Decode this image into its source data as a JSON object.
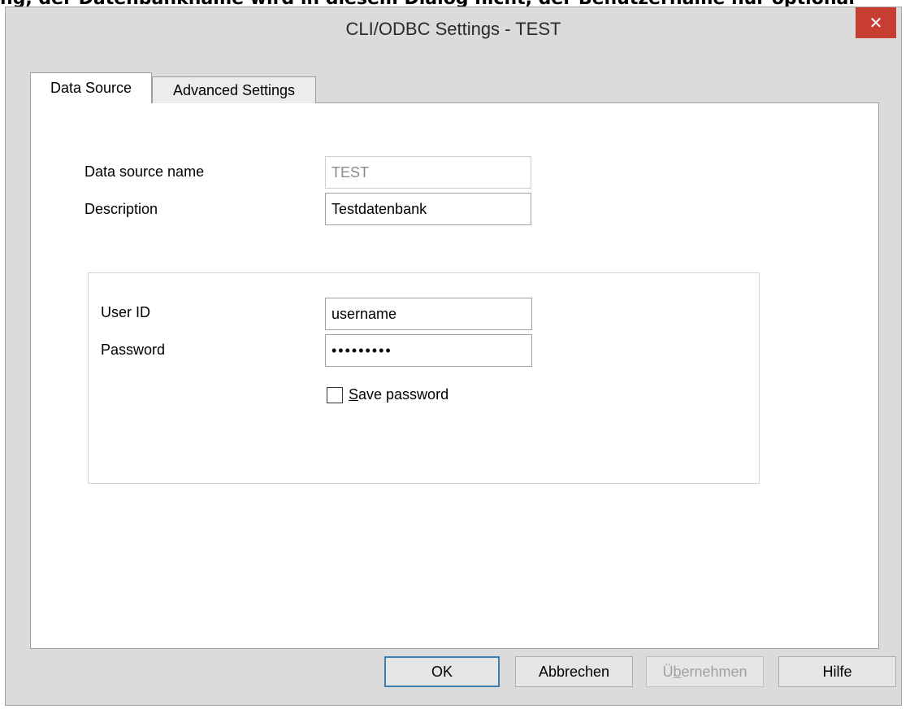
{
  "partial_text": "ng, der Datenbankname wird in diesem Dialog nicht, der Benutzername nur optional",
  "window": {
    "title": "CLI/ODBC Settings - TEST",
    "close_glyph": "✕"
  },
  "tabs": [
    {
      "label": "Data Source",
      "active": true
    },
    {
      "label": "Advanced Settings",
      "active": false
    }
  ],
  "form": {
    "data_source_name_label": "Data source name",
    "data_source_name_value": "TEST",
    "description_label": "Description",
    "description_value": "Testdatenbank",
    "user_id_label": "User ID",
    "user_id_value": "username",
    "password_label": "Password",
    "password_value": "•••••••••",
    "save_password_mnemonic": "S",
    "save_password_rest": "ave password",
    "save_password_checked": false
  },
  "buttons": {
    "ok": "OK",
    "cancel": "Abbrechen",
    "apply_mnemonic": "Ü",
    "apply_middle": "b",
    "apply_rest": "ernehmen",
    "help": "Hilfe"
  },
  "colors": {
    "window_bg": "#dbdbdb",
    "close_button": "#c73d32",
    "default_button_border": "#3c7fb1"
  }
}
